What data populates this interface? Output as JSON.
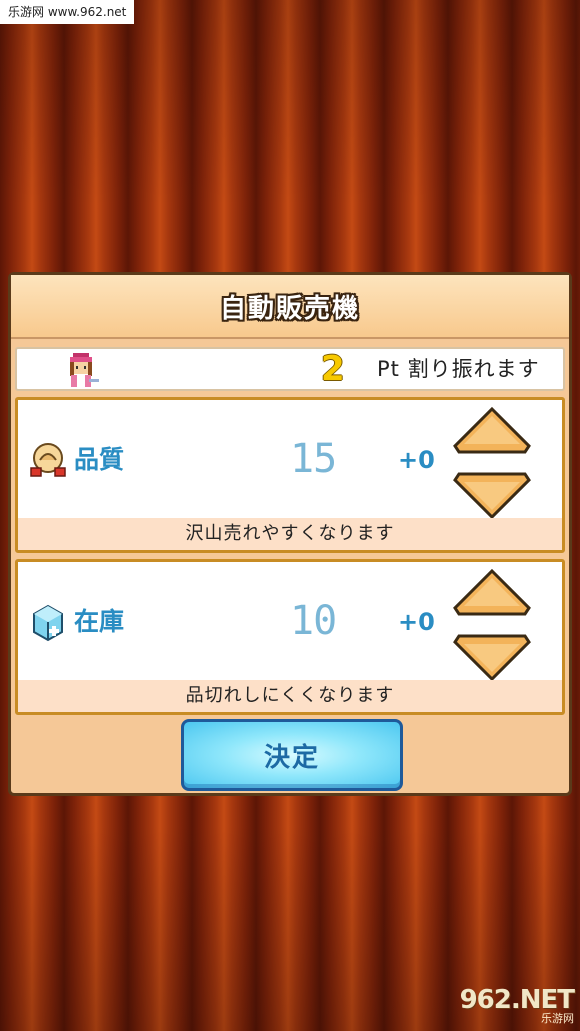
{
  "watermark": {
    "site": "乐游网 www.962.net",
    "logo_big": "962.NET",
    "logo_small": "乐游网"
  },
  "dialog": {
    "title": "自動販売機",
    "points": {
      "value": "2",
      "text": "Pt 割り振れます",
      "avatar_icon": "staff-avatar-icon"
    },
    "stats": [
      {
        "name": "品質",
        "value": "15",
        "delta": "+0",
        "description": "沢山売れやすくなります",
        "icon": "quality-icon"
      },
      {
        "name": "在庫",
        "value": "10",
        "delta": "+0",
        "description": "品切れしにくくなります",
        "icon": "stock-cube-icon"
      }
    ],
    "confirm_label": "決定"
  },
  "colors": {
    "accent_blue": "#2a8dc3",
    "arrow_orange": "#f3b35a",
    "points_yellow": "#f7c900"
  }
}
